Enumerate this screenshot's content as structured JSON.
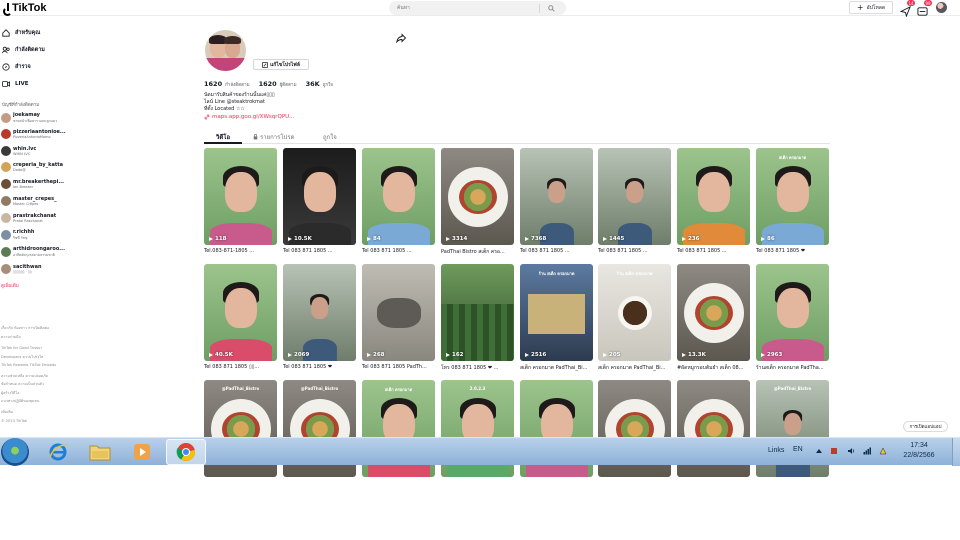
{
  "app": {
    "logo_text": "TikTok"
  },
  "search": {
    "placeholder": "ค้นหา"
  },
  "topbar": {
    "upload_label": "อัปโหลด",
    "inbox_badge": "14",
    "notif_badge": "99"
  },
  "sidebar": {
    "nav": [
      {
        "label": "สำหรับคุณ",
        "icon": "home-icon"
      },
      {
        "label": "กำลังติดตาม",
        "icon": "following-icon"
      },
      {
        "label": "สำรวจ",
        "icon": "explore-icon"
      },
      {
        "label": "LIVE",
        "icon": "live-icon"
      }
    ],
    "section_title": "บัญชีที่กำลังติดตาม",
    "accounts": [
      {
        "name": "joekamay",
        "sub": "ขายหน้าเฟือสาราแถมลูกแมว"
      },
      {
        "name": "pizzeriaantonioe...",
        "sub": "PizzeriaAntonioMomo"
      },
      {
        "name": "whin.lvc",
        "sub": "WHIN LVC"
      },
      {
        "name": "creperia_by_katta",
        "sub": "Dodo@"
      },
      {
        "name": "mr.breakerthepi...",
        "sub": "Ian Breaker"
      },
      {
        "name": "master_crepes_",
        "sub": "Master Crêpes"
      },
      {
        "name": "prastrakchanat",
        "sub": "Pratal Rakchanat"
      },
      {
        "name": "r.richhh",
        "sub": "ริชชี่ รัชชุ"
      },
      {
        "name": "arthidroongaroo...",
        "sub": "อาทิตย์ปรุงรสตามธรรมชาติ"
      },
      {
        "name": "sacithwan",
        "sub": "▯▯▯▯▯▯ · ▯▯"
      }
    ],
    "see_more": "ดูเพิ่มเติม",
    "footer": [
      "เกี่ยวกับ ห้องข่าว การเปิดติดต่อ",
      "ความร่วมมือ",
      "TikTok for Good โฆษณา",
      "Developers ความโปร่งใส",
      "TikTok Rewards TikTok Embeds",
      "ความช่วยเหลือ ความปลอดภัย",
      "ข้อกำหนด ความเป็นส่วนตัว",
      "ผู้สร้างวิดีโอ",
      "แนวทางปฏิบัติของชุมชน",
      "เพิ่มเติม",
      "© 2023 TikTok"
    ]
  },
  "profile": {
    "edit_label": "แก้ไขโปรไฟล์",
    "stats": [
      {
        "num": "1620",
        "label": "กำลังติดตาม"
      },
      {
        "num": "1620",
        "label": "ผู้ติดตาม"
      },
      {
        "num": "36K",
        "label": "ถูกใจ"
      }
    ],
    "bio": [
      "นัดมารับสินค้าของร้านนั้นแค่▯▯▯",
      "ไลน์ Line @steaktrokmat",
      "ที่ตั้ง Located ☆☆"
    ],
    "link": "maps.app.goo.gl/XWsqrQPU..."
  },
  "tabs": [
    {
      "label": "วิดีโอ",
      "icon": ""
    },
    {
      "label": "รายการโปรด",
      "icon": "lock-icon"
    },
    {
      "label": "ถูกใจ",
      "icon": ""
    }
  ],
  "videos": [
    {
      "views": "118",
      "caption": "Tel.083-871-1805 ...",
      "kind": "face"
    },
    {
      "views": "10.5K",
      "caption": "Tel 083 871 1805 ...",
      "kind": "dark"
    },
    {
      "views": "84",
      "caption": "Tel 083 871 1805 ...",
      "kind": "face"
    },
    {
      "views": "3314",
      "caption": "PadThai Bistro สเต็ก ครอ...",
      "kind": "food",
      "overlay": ""
    },
    {
      "views": "7368",
      "caption": "Tel 083 871 1805 ...",
      "kind": "street"
    },
    {
      "views": "1445",
      "caption": "Tel 083 871 1805 ...",
      "kind": "street"
    },
    {
      "views": "236",
      "caption": "Tel 083 871 1805 ...",
      "kind": "face"
    },
    {
      "views": "86",
      "caption": "Tel 083 871 1805 ❤",
      "kind": "face",
      "overlay": "สเต็ก ครอกมาต"
    },
    {
      "views": "40.5K",
      "caption": "Tel 083 871 1805 ▯▯...",
      "kind": "face"
    },
    {
      "views": "2069",
      "caption": "Tel 083 871 1805 ❤",
      "kind": "street"
    },
    {
      "views": "268",
      "caption": "Tel 083 871 1805 PadTh...",
      "kind": "cat"
    },
    {
      "views": "162",
      "caption": "โทร 083 871 1805 ❤ ...",
      "kind": "garden"
    },
    {
      "views": "2516",
      "caption": "สเต็ก ครอกมาต PadThai_Bi...",
      "kind": "shop",
      "overlay": "ร้าน สเต็ก ครอกมาต"
    },
    {
      "views": "205",
      "caption": "สเต็ก ครอกมาต PadThai_Bi...",
      "kind": "cup",
      "overlay": "ร้าน สเต็ก ครอกมาต"
    },
    {
      "views": "13.3K",
      "caption": "#ผัดหมูกรอบต้มยำ สเต็ก 08...",
      "kind": "food"
    },
    {
      "views": "2963",
      "caption": "ร้านสเต็ก ครอกมาต PadTha...",
      "kind": "face"
    },
    {
      "views": "",
      "caption": "",
      "kind": "food",
      "overlay": "@PadThai_Bistro"
    },
    {
      "views": "",
      "caption": "",
      "kind": "food",
      "overlay": "@PadThai_Bistro"
    },
    {
      "views": "",
      "caption": "",
      "kind": "face",
      "overlay": "สเต็ก ครอกมาต"
    },
    {
      "views": "",
      "caption": "",
      "kind": "face",
      "overlay": "2.0.2.3"
    },
    {
      "views": "",
      "caption": "",
      "kind": "face",
      "overlay": ""
    },
    {
      "views": "",
      "caption": "",
      "kind": "food",
      "overlay": ""
    },
    {
      "views": "",
      "caption": "",
      "kind": "food",
      "overlay": ""
    },
    {
      "views": "",
      "caption": "",
      "kind": "street",
      "overlay": "@PadThai_Bistro"
    }
  ],
  "get_app": "การเปิดแอปแอป",
  "taskbar": {
    "apps": [
      {
        "name": "ie-icon"
      },
      {
        "name": "explorer-icon"
      },
      {
        "name": "media-player-icon"
      },
      {
        "name": "chrome-icon"
      }
    ],
    "links_label": "Links",
    "lang": "EN",
    "time": "17:34",
    "date": "22/8/2566"
  },
  "colors": {
    "accent": "#fe2c55",
    "taskbar": "#9fbde0"
  }
}
